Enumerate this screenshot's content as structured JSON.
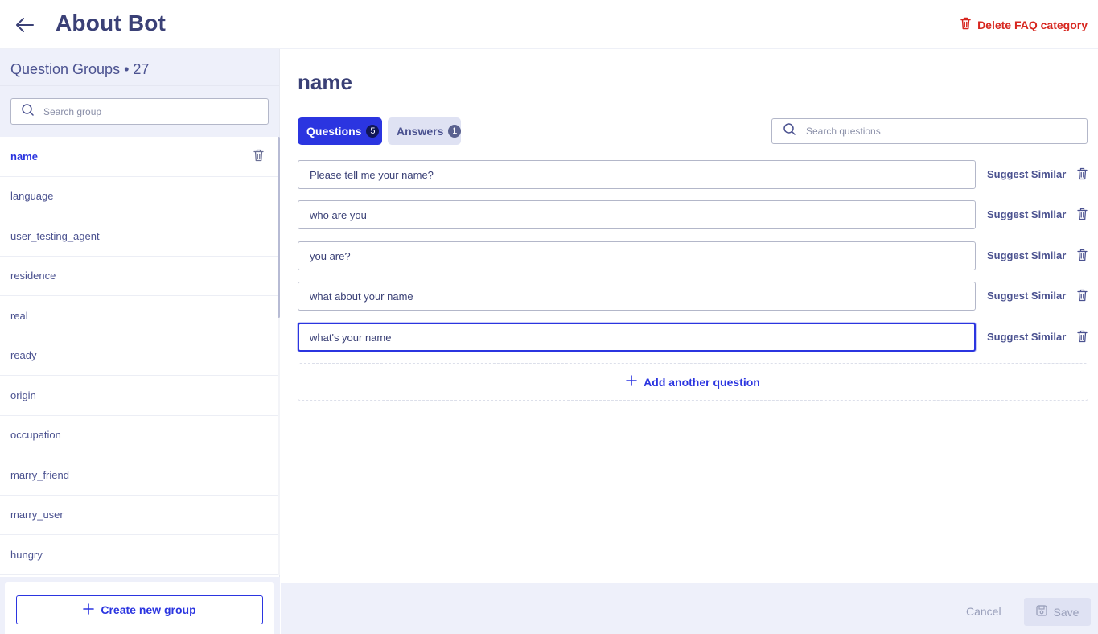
{
  "header": {
    "title": "About Bot",
    "delete_label": "Delete FAQ category"
  },
  "sidebar": {
    "heading": "Question Groups • 27",
    "search_placeholder": "Search group",
    "groups": [
      {
        "label": "name",
        "active": true
      },
      {
        "label": "language"
      },
      {
        "label": "user_testing_agent"
      },
      {
        "label": "residence"
      },
      {
        "label": "real"
      },
      {
        "label": "ready"
      },
      {
        "label": "origin"
      },
      {
        "label": "occupation"
      },
      {
        "label": "marry_friend"
      },
      {
        "label": "marry_user"
      },
      {
        "label": "hungry"
      }
    ],
    "create_label": "Create new group"
  },
  "main": {
    "group_title": "name",
    "tabs": [
      {
        "label": "Questions",
        "count": "5",
        "active": true
      },
      {
        "label": "Answers",
        "count": "1"
      }
    ],
    "search_placeholder": "Search questions",
    "questions": [
      {
        "value": "Please tell me your name?"
      },
      {
        "value": "who are you"
      },
      {
        "value": "you are?"
      },
      {
        "value": "what about your name"
      },
      {
        "value": "what's your name",
        "focused": true
      }
    ],
    "suggest_label": "Suggest Similar",
    "add_label": "Add another question"
  },
  "footer": {
    "cancel_label": "Cancel",
    "save_label": "Save"
  },
  "colors": {
    "accent": "#2b35e0",
    "danger": "#d7261f",
    "text": "#3a4076",
    "panel": "#eef0fa"
  }
}
